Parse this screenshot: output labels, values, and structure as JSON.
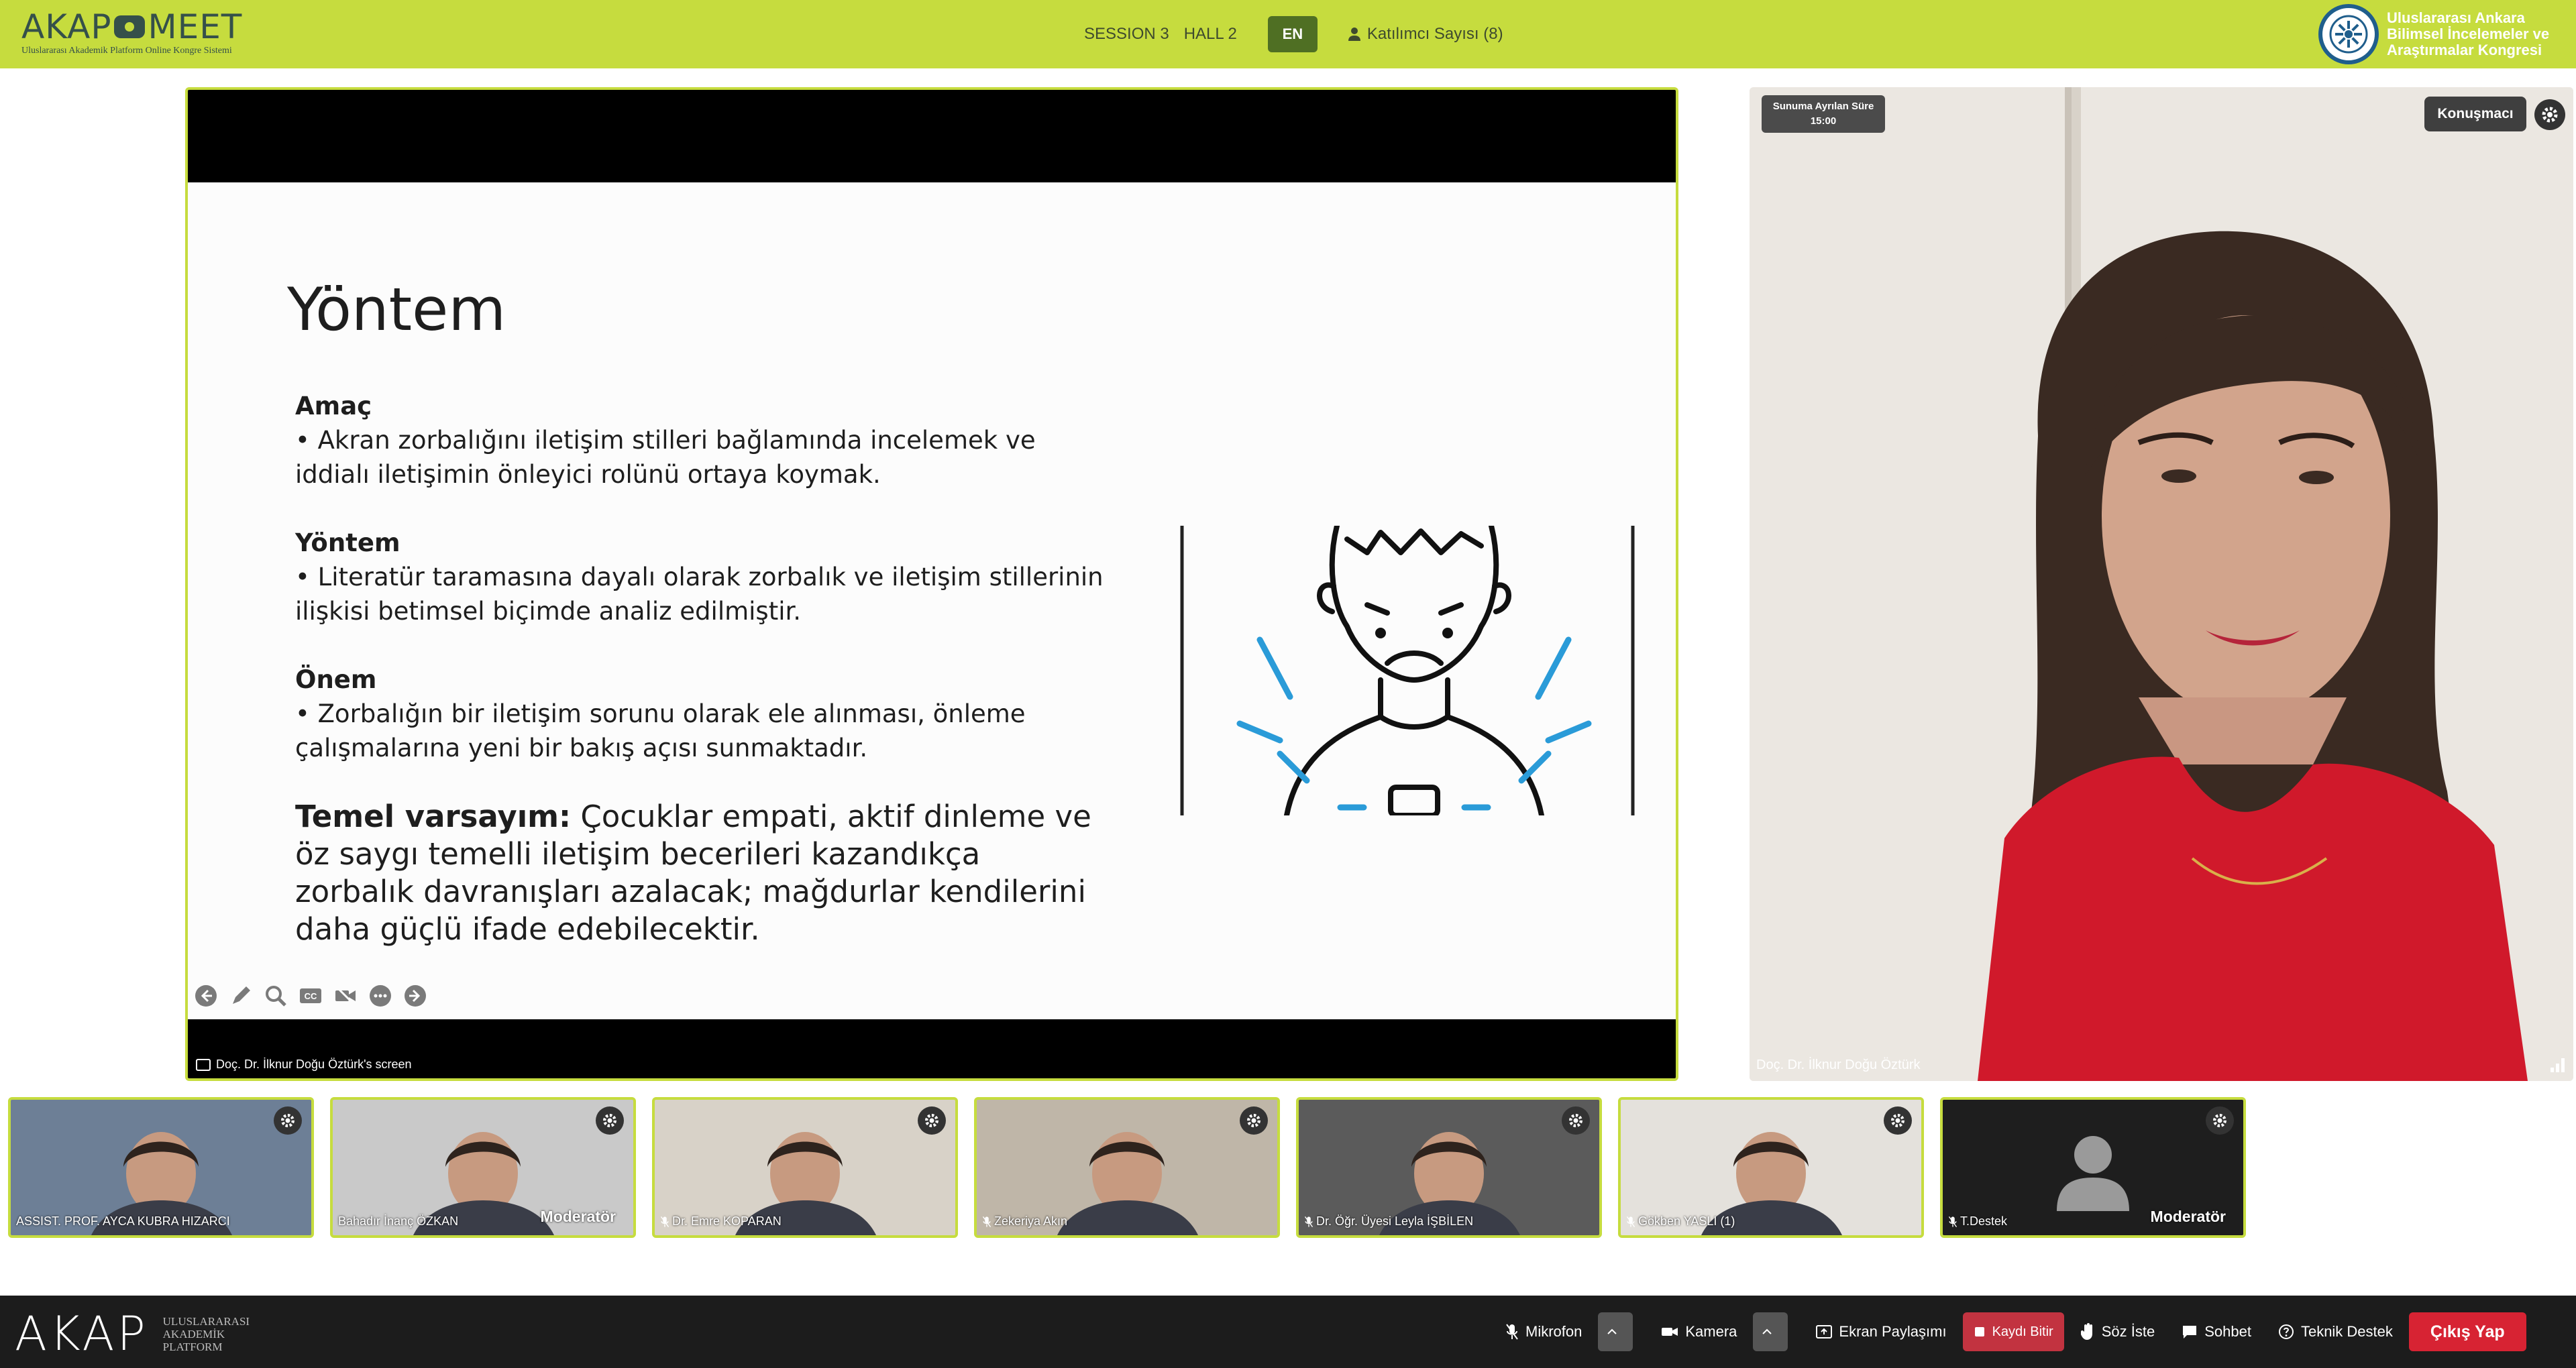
{
  "header": {
    "logo_left": "AKAP",
    "logo_right": "MEET",
    "logo_subtitle": "Uluslararası Akademik Platform Online Kongre Sistemi",
    "session": "SESSION 3",
    "hall": "HALL 2",
    "language": "EN",
    "participants": "Katılımcı Sayısı (8)",
    "congress_name": "Uluslararası Ankara Bilimsel İncelemeler ve Araştırmalar Kongresi",
    "accent_color": "#c6dc3e"
  },
  "slide": {
    "title": "Yöntem",
    "sections": [
      {
        "heading": "Amaç",
        "text": "• Akran zorbalığını iletişim stilleri bağlamında incelemek ve iddialı iletişimin önleyici rolünü ortaya koymak."
      },
      {
        "heading": "Yöntem",
        "text": "• Literatür taramasına dayalı olarak zorbalık ve iletişim stillerinin ilişkisi betimsel biçimde analiz edilmiştir."
      },
      {
        "heading": "Önem",
        "text": "• Zorbalığın bir iletişim sorunu olarak ele alınması, önleme çalışmalarına yeni bir bakış açısı sunmaktadır."
      }
    ],
    "thesis_label": "Temel varsayım:",
    "thesis_text": " Çocuklar empati, aktif dinleme ve öz saygı temelli iletişim becerileri kazandıkça zorbalık davranışları azalacak; mağdurlar kendilerini daha güçlü ifade edebilecektir.",
    "screen_owner": "Doç. Dr. İlknur Doğu Öztürk's screen",
    "tools": [
      "back-arrow-icon",
      "pen-icon",
      "zoom-icon",
      "captions-icon",
      "video-off-icon",
      "more-icon",
      "forward-arrow-icon"
    ]
  },
  "speaker": {
    "timer_label": "Sunuma Ayrılan Süre",
    "timer_value": "15:00",
    "badge": "Konuşmacı",
    "name": "Doç. Dr. İlknur Doğu Öztürk"
  },
  "participants": [
    {
      "name": "ASSIST. PROF. AYCA KUBRA HIZARCI",
      "moderator": "",
      "muted": false,
      "bg": "#6d7f96"
    },
    {
      "name": "Bahadır İnanç ÖZKAN",
      "moderator": "Moderatör",
      "muted": false,
      "bg": "#c9c9c9"
    },
    {
      "name": "Dr. Emre KOPARAN",
      "moderator": "",
      "muted": true,
      "bg": "#d8d2c8"
    },
    {
      "name": "Zekeriya Akın",
      "moderator": "",
      "muted": true,
      "bg": "#bfb6a8"
    },
    {
      "name": "Dr. Öğr. Üyesi Leyla İŞBİLEN",
      "moderator": "",
      "muted": true,
      "bg": "#5b5b5b"
    },
    {
      "name": "Gökben YASLI (1)",
      "moderator": "",
      "muted": true,
      "bg": "#e4e1dc"
    },
    {
      "name": "T.Destek",
      "moderator": "Moderatör",
      "muted": true,
      "bg": "#1e1e1e"
    }
  ],
  "bottom": {
    "logo": "AKAP",
    "logo_sub": "ULUSLARARASI AKADEMİK PLATFORM",
    "mic": "Mikrofon",
    "camera": "Kamera",
    "share": "Ekran Paylaşımı",
    "record": "Kaydı Bitir",
    "raise": "Söz İste",
    "chat": "Sohbet",
    "support": "Teknik Destek",
    "exit": "Çıkış Yap"
  }
}
